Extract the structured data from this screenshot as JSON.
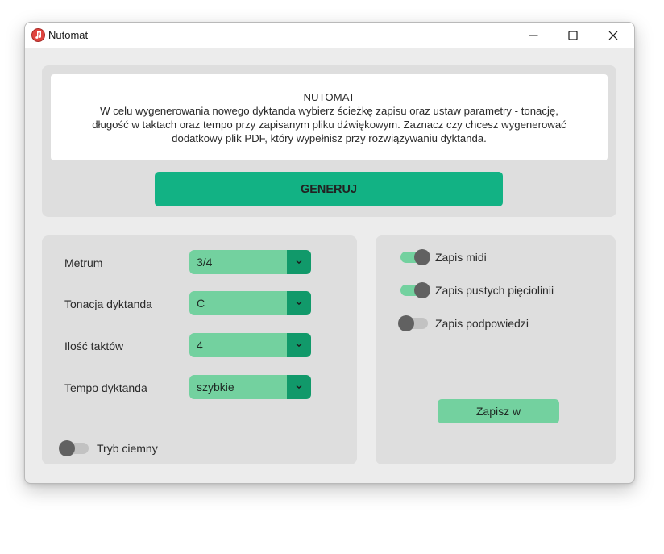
{
  "window": {
    "title": "Nutomat",
    "app_icon": "music-note-icon"
  },
  "titlebar_buttons": {
    "minimize": "minimize-icon",
    "maximize": "maximize-icon",
    "close": "close-icon"
  },
  "info": {
    "title": "NUTOMAT",
    "body": "W celu wygenerowania nowego dyktanda wybierz ścieżkę zapisu oraz ustaw parametry - tonację, długość w taktach oraz tempo przy zapisanym pliku dźwiękowym. Zaznacz czy chcesz wygenerować dodatkowy plik PDF, który wypełnisz przy rozwiązywaniu dyktanda."
  },
  "generate_label": "GENERUJ",
  "params": [
    {
      "label": "Metrum",
      "value": "3/4"
    },
    {
      "label": "Tonacja dyktanda",
      "value": "C"
    },
    {
      "label": "Ilość taktów",
      "value": "4"
    },
    {
      "label": "Tempo dyktanda",
      "value": "szybkie"
    }
  ],
  "dark_mode": {
    "label": "Tryb ciemny",
    "on": false
  },
  "save_options": [
    {
      "label": "Zapis midi",
      "on": true
    },
    {
      "label": "Zapis pustych pięciolinii",
      "on": true
    },
    {
      "label": "Zapis podpowiedzi",
      "on": false
    }
  ],
  "save_label": "Zapisz w",
  "colors": {
    "accent": "#12b284",
    "accent_light": "#73d19f",
    "accent_dark": "#11996a",
    "panel": "#dedede",
    "background": "#ececec"
  }
}
